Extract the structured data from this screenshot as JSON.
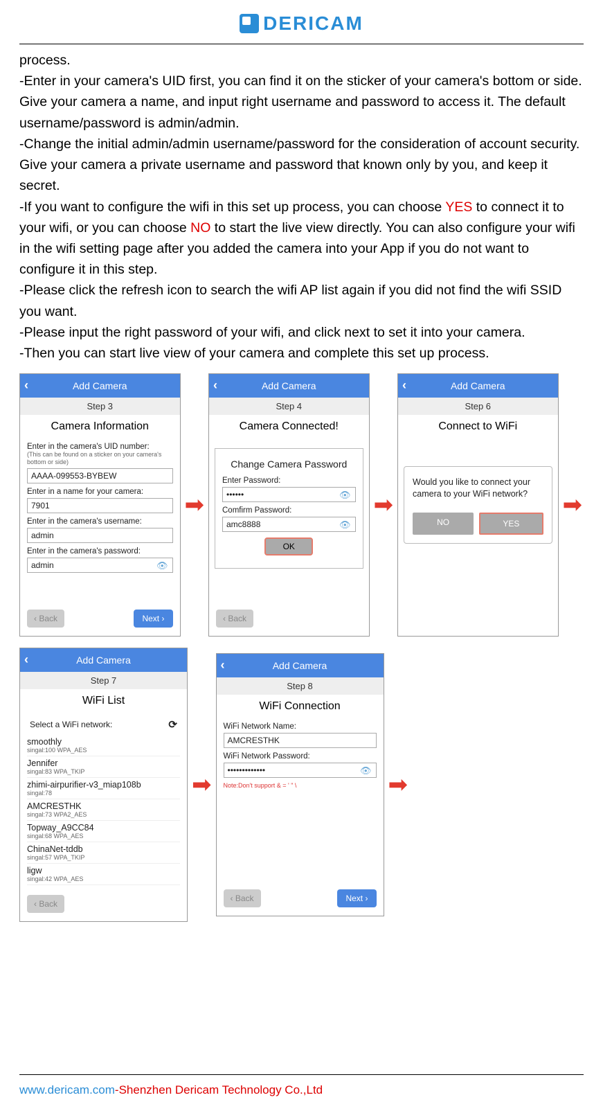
{
  "brand": "DERICAM",
  "paragraphs": {
    "p0": "process.",
    "p1": "-Enter in your camera's UID first, you can find it on the sticker of your camera's bottom or side. Give your camera a name, and input right username and password to access it. The default username/password is admin/admin.",
    "p2": "-Change the initial admin/admin username/password for the consideration of account security. Give your camera a private username and password that known only by you, and keep it secret.",
    "p3a": "-If you want to configure the wifi in this set up process, you can choose ",
    "p3yes": "YES",
    "p3b": " to connect it to your wifi, or you can choose ",
    "p3no": "NO",
    "p3c": " to start the live view directly. You can also configure your wifi in the wifi setting page after you added the camera into your App if you do not want to configure it in this step.",
    "p4": "-Please click the refresh icon to search the wifi AP list again if you did not find the wifi SSID you want.",
    "p5": "-Please input the right password of your wifi, and click next to set it into your camera.",
    "p6": "-Then you can start live view of your camera and complete this set up process."
  },
  "common": {
    "appbar_title": "Add Camera",
    "back_label": "Back",
    "next_label": "Next",
    "ok_label": "OK",
    "no_label": "NO",
    "yes_label": "YES",
    "back_glyph": "‹",
    "arrow_glyph": "➡"
  },
  "step3": {
    "step": "Step 3",
    "title": "Camera Information",
    "uid_label": "Enter in the camera's UID number:",
    "uid_hint": "(This can be found on a sticker on your camera's bottom or side)",
    "uid_value": "AAAA-099553-BYBEW",
    "name_label": "Enter in a name for your camera:",
    "name_value": "7901",
    "user_label": "Enter in the camera's username:",
    "user_value": "admin",
    "pass_label": "Enter in the camera's password:",
    "pass_value": "admin"
  },
  "step4": {
    "step": "Step 4",
    "title": "Camera Connected!",
    "popup_title": "Change Camera Password",
    "enter_pw": "Enter Password:",
    "enter_pw_value": "••••••",
    "confirm_pw": "Comfirm Password:",
    "confirm_pw_value": "amc8888"
  },
  "step6": {
    "step": "Step 6",
    "title": "Connect to WiFi",
    "dialog": "Would you like to connect your camera to your WiFi network?"
  },
  "step7": {
    "step": "Step 7",
    "title": "WiFi List",
    "select": "Select a WiFi network:",
    "refresh_glyph": "⟳",
    "items": [
      {
        "ssid": "smoothly",
        "meta": "singal:100   WPA_AES"
      },
      {
        "ssid": "Jennifer",
        "meta": "singal:83   WPA_TKIP"
      },
      {
        "ssid": "zhimi-airpurifier-v3_miap108b",
        "meta": "singal:78"
      },
      {
        "ssid": "AMCRESTHK",
        "meta": "singal:73   WPA2_AES"
      },
      {
        "ssid": "Topway_A9CC84",
        "meta": "singal:68   WPA_AES"
      },
      {
        "ssid": "ChinaNet-tddb",
        "meta": "singal:57   WPA_TKIP"
      },
      {
        "ssid": "ligw",
        "meta": "singal:42   WPA_AES"
      }
    ]
  },
  "step8": {
    "step": "Step 8",
    "title": "WiFi Connection",
    "name_label": "WiFi Network Name:",
    "name_value": "AMCRESTHK",
    "pw_label": "WiFi Network Password:",
    "pw_value": "•••••••••••••",
    "note": "Note:Don't support & = ' \" \\"
  },
  "footer": {
    "url": "www.dericam.com",
    "dash": "-",
    "company": "Shenzhen Dericam Technology Co.,Ltd"
  }
}
